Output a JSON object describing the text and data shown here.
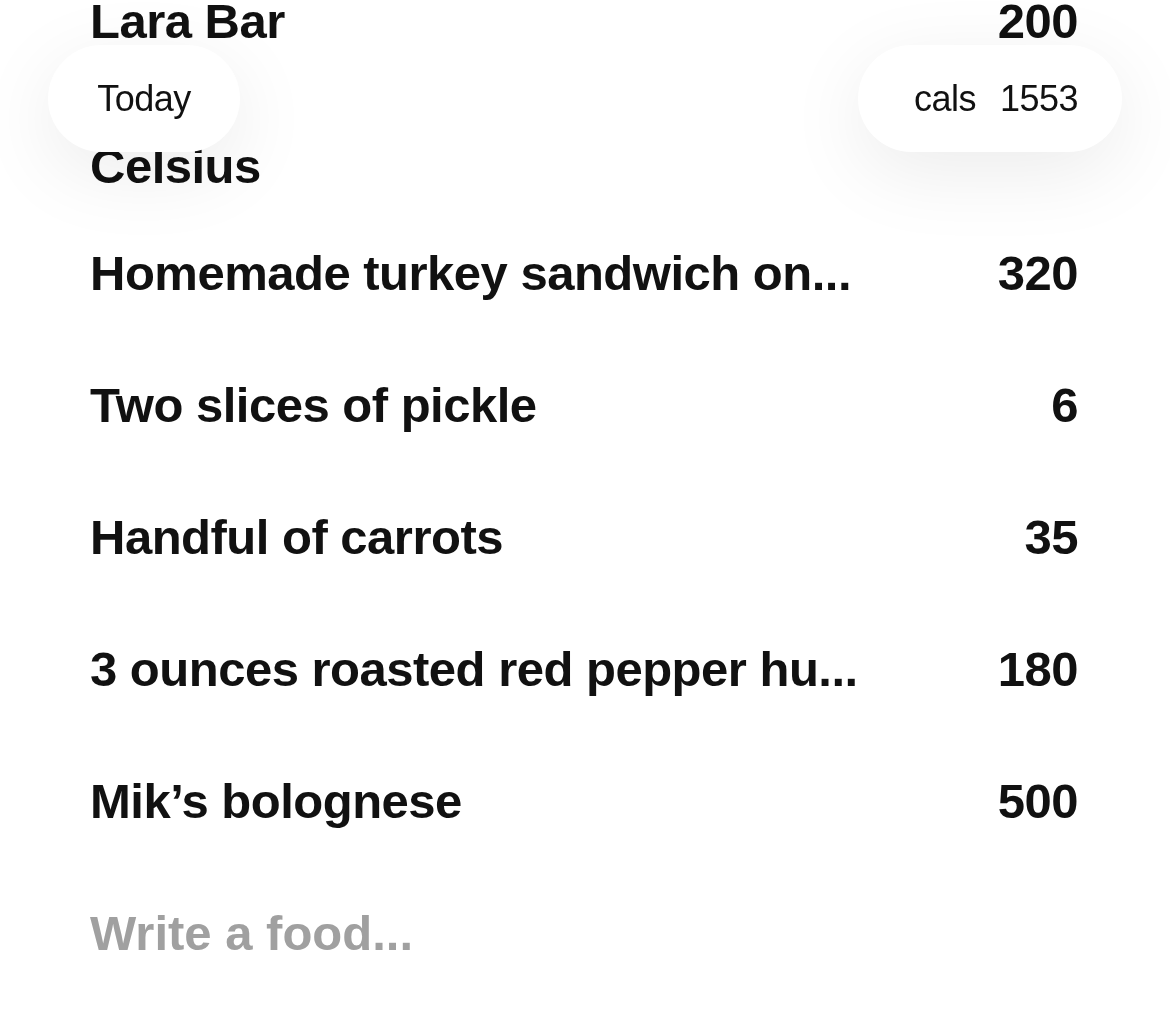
{
  "header": {
    "date_label": "Today",
    "total_label": "cals",
    "total_value": "1553"
  },
  "foods": [
    {
      "name": "Lara Bar",
      "cals": "200"
    },
    {
      "name": "Celsius"
    },
    {
      "name": "Homemade turkey sandwich on...",
      "cals": "320"
    },
    {
      "name": "Two slices of pickle",
      "cals": "6"
    },
    {
      "name": "Handful of carrots",
      "cals": "35"
    },
    {
      "name": "3 ounces roasted red pepper hu...",
      "cals": "180"
    },
    {
      "name": "Mik’s bolognese",
      "cals": "500"
    }
  ],
  "entry": {
    "placeholder": "Write a food..."
  }
}
